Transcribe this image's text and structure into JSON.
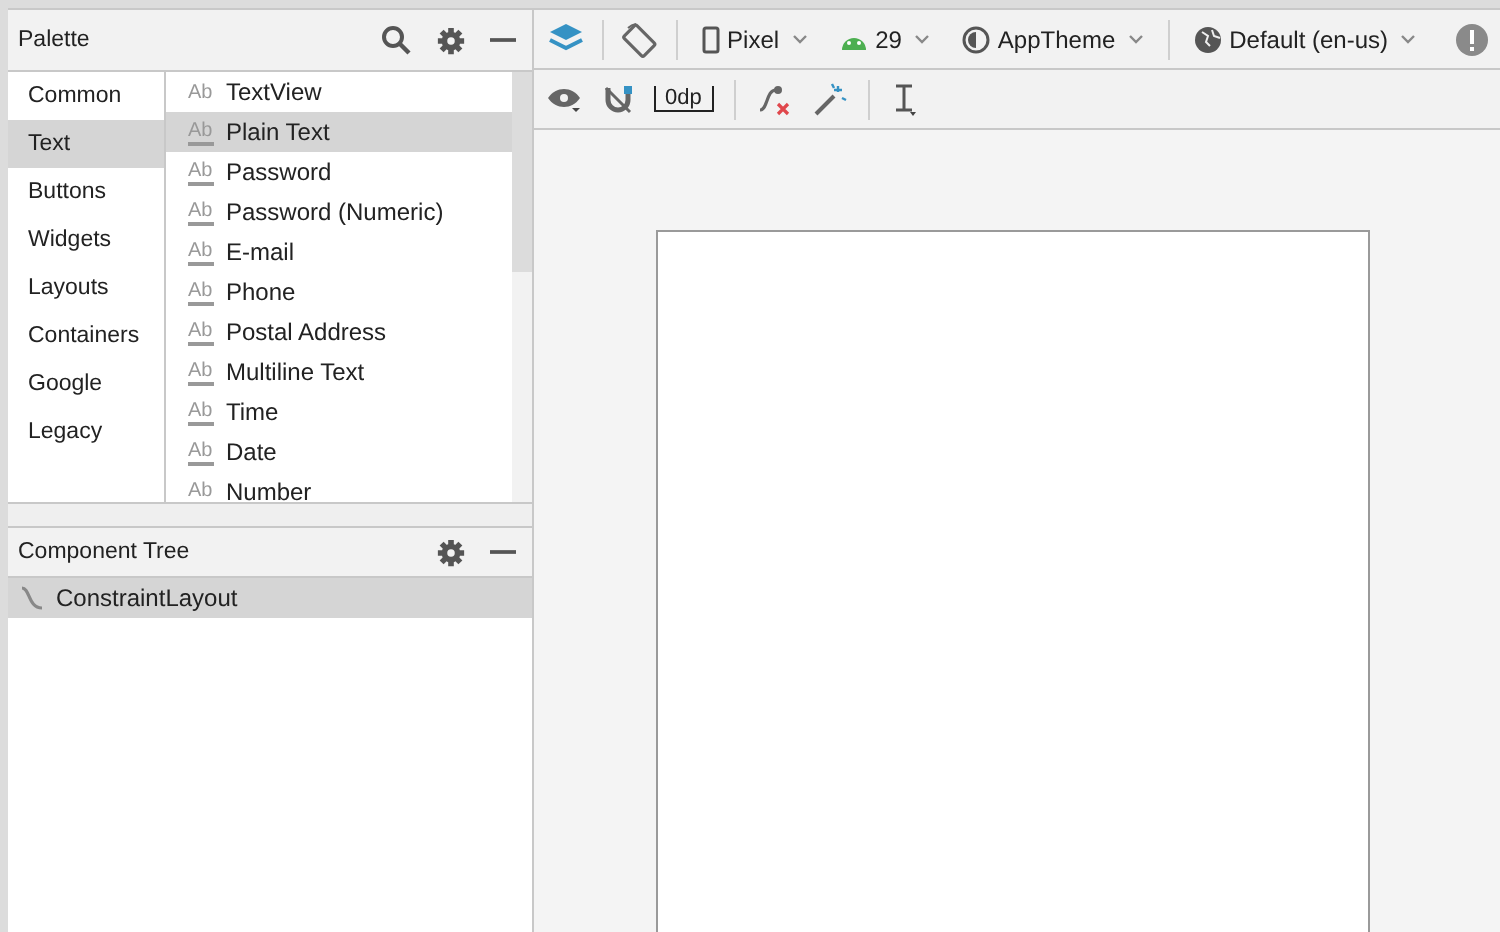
{
  "palette": {
    "title": "Palette",
    "categories": [
      {
        "label": "Common",
        "selected": false
      },
      {
        "label": "Text",
        "selected": true
      },
      {
        "label": "Buttons",
        "selected": false
      },
      {
        "label": "Widgets",
        "selected": false
      },
      {
        "label": "Layouts",
        "selected": false
      },
      {
        "label": "Containers",
        "selected": false
      },
      {
        "label": "Google",
        "selected": false
      },
      {
        "label": "Legacy",
        "selected": false
      }
    ],
    "items": [
      {
        "icon": "Ab",
        "kind": "view",
        "label": "TextView",
        "selected": false
      },
      {
        "icon": "Ab",
        "kind": "edit",
        "label": "Plain Text",
        "selected": true
      },
      {
        "icon": "Ab",
        "kind": "edit",
        "label": "Password",
        "selected": false
      },
      {
        "icon": "Ab",
        "kind": "edit",
        "label": "Password (Numeric)",
        "selected": false
      },
      {
        "icon": "Ab",
        "kind": "edit",
        "label": "E-mail",
        "selected": false
      },
      {
        "icon": "Ab",
        "kind": "edit",
        "label": "Phone",
        "selected": false
      },
      {
        "icon": "Ab",
        "kind": "edit",
        "label": "Postal Address",
        "selected": false
      },
      {
        "icon": "Ab",
        "kind": "edit",
        "label": "Multiline Text",
        "selected": false
      },
      {
        "icon": "Ab",
        "kind": "edit",
        "label": "Time",
        "selected": false
      },
      {
        "icon": "Ab",
        "kind": "edit",
        "label": "Date",
        "selected": false
      },
      {
        "icon": "Ab",
        "kind": "edit",
        "label": "Number",
        "selected": false
      }
    ]
  },
  "component_tree": {
    "title": "Component Tree",
    "nodes": [
      {
        "label": "ConstraintLayout",
        "selected": true
      }
    ]
  },
  "toolbar": {
    "device": "Pixel",
    "api": "29",
    "theme": "AppTheme",
    "locale": "Default (en-us)",
    "margin": "0dp"
  }
}
